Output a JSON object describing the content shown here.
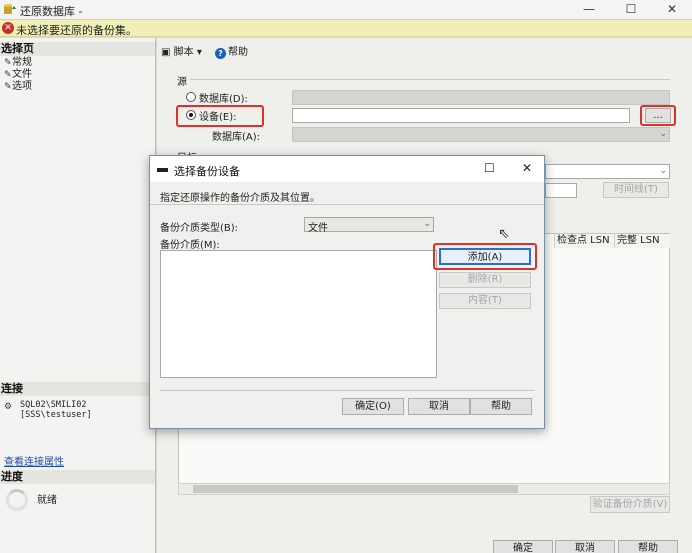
{
  "window": {
    "title": "还原数据库 -",
    "minimize": "—",
    "maximize": "☐",
    "close": "✕"
  },
  "warning": {
    "icon": "error-icon",
    "text": "未选择要还原的备份集。"
  },
  "left": {
    "select_page_header": "选择页",
    "pages": [
      "常规",
      "文件",
      "选项"
    ],
    "connection_header": "连接",
    "server": "SQL02\\SMILI02",
    "user": "[SSS\\testuser]",
    "view_connection_link": "查看连接属性",
    "progress_header": "进度",
    "progress_status": "就绪"
  },
  "toolbar": {
    "script_label": "脚本",
    "script_arrow": "▾",
    "help_label": "帮助"
  },
  "source": {
    "group_label": "源",
    "database_label": "数据库(D):",
    "device_label": "设备(E):",
    "db_label": "数据库(A):",
    "browse_label": "...",
    "selected": "device"
  },
  "target": {
    "group_label": "目标",
    "timeline_button": "时间线(T)"
  },
  "grid": {
    "columns": [
      "检查点 LSN",
      "完整 LSN"
    ]
  },
  "bottom": {
    "verify_button": "验证备份介质(V)",
    "ok": "确定",
    "cancel": "取消",
    "help": "帮助"
  },
  "dialog": {
    "title": "选择备份设备",
    "close": "✕",
    "maximize": "☐",
    "description": "指定还原操作的备份介质及其位置。",
    "media_type_label": "备份介质类型(B):",
    "media_type_value": "文件",
    "media_label": "备份介质(M):",
    "add_button": "添加(A)",
    "remove_button": "删除(R)",
    "contents_button": "内容(T)",
    "ok": "确定(O)",
    "cancel": "取消",
    "help": "帮助"
  },
  "colors": {
    "highlight_red": "#e0302c",
    "warning_bg": "#f1efb8",
    "link_blue": "#1f4fa8"
  }
}
